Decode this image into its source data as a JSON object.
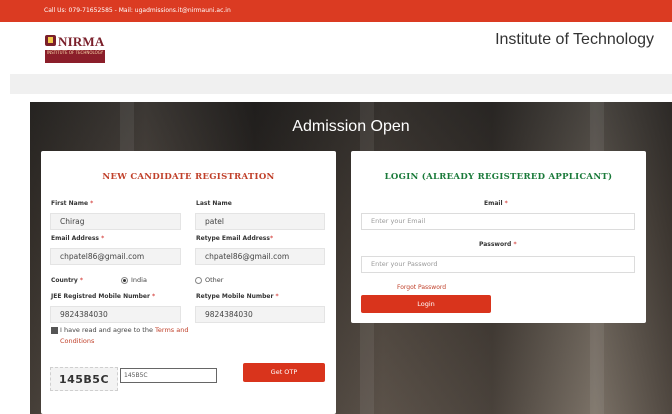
{
  "topbar": {
    "contact": "Call Us: 079-71652585 - Mail: ugadmissions.it@nirmauni.ac.in"
  },
  "header": {
    "logo_name": "NIRMA",
    "logo_sub": "INSTITUTE OF TECHNOLOGY",
    "institute": "Institute of Technology"
  },
  "hero": {
    "title": "Admission Open"
  },
  "registration": {
    "title": "NEW CANDIDATE REGISTRATION",
    "first_name_label": "First Name",
    "first_name_value": "Chirag",
    "last_name_label": "Last Name",
    "last_name_value": "patel",
    "email_label": "Email Address",
    "email_value": "chpatel86@gmail.com",
    "retype_email_label": "Retype Email Address",
    "retype_email_value": "chpatel86@gmail.com",
    "country_label": "Country",
    "country_options": [
      "India",
      "Other"
    ],
    "country_selected": "India",
    "mobile_label": "JEE Registred Mobile Number",
    "mobile_value": "9824384030",
    "retype_mobile_label": "Retype Mobile Number",
    "retype_mobile_value": "9824384030",
    "agree_text": "I have read and agree to the",
    "terms_link": "Terms and Conditions",
    "captcha_text": "145B5C",
    "captcha_input_value": "145B5C",
    "otp_button": "Get OTP",
    "required_mark": "*"
  },
  "login": {
    "title": "LOGIN (ALREADY REGISTERED APPLICANT)",
    "email_label": "Email",
    "email_placeholder": "Enter your Email",
    "password_label": "Password",
    "password_placeholder": "Enter your Password",
    "forgot_link": "Forgot Password",
    "login_button": "Login",
    "required_mark": "*"
  },
  "colors": {
    "brand_red": "#db3b22",
    "button_red": "#d9341c",
    "login_title_green": "#1a7a3a",
    "reg_title_red": "#c0402a"
  }
}
